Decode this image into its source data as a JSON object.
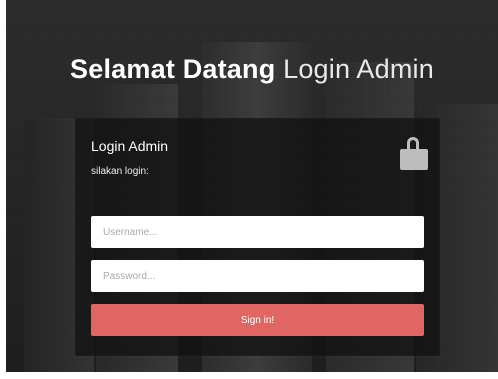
{
  "page": {
    "title_strong": "Selamat Datang",
    "title_light": "Login Admin"
  },
  "login_panel": {
    "title": "Login Admin",
    "subtitle": "silakan login:",
    "icon": "lock-icon"
  },
  "form": {
    "username_placeholder": "Username...",
    "password_placeholder": "Password...",
    "submit_label": "Sign in!"
  },
  "colors": {
    "button_bg": "#e06563",
    "panel_bg": "rgba(18, 18, 18, 0.78)",
    "lock_icon": "#bdbdbd"
  }
}
